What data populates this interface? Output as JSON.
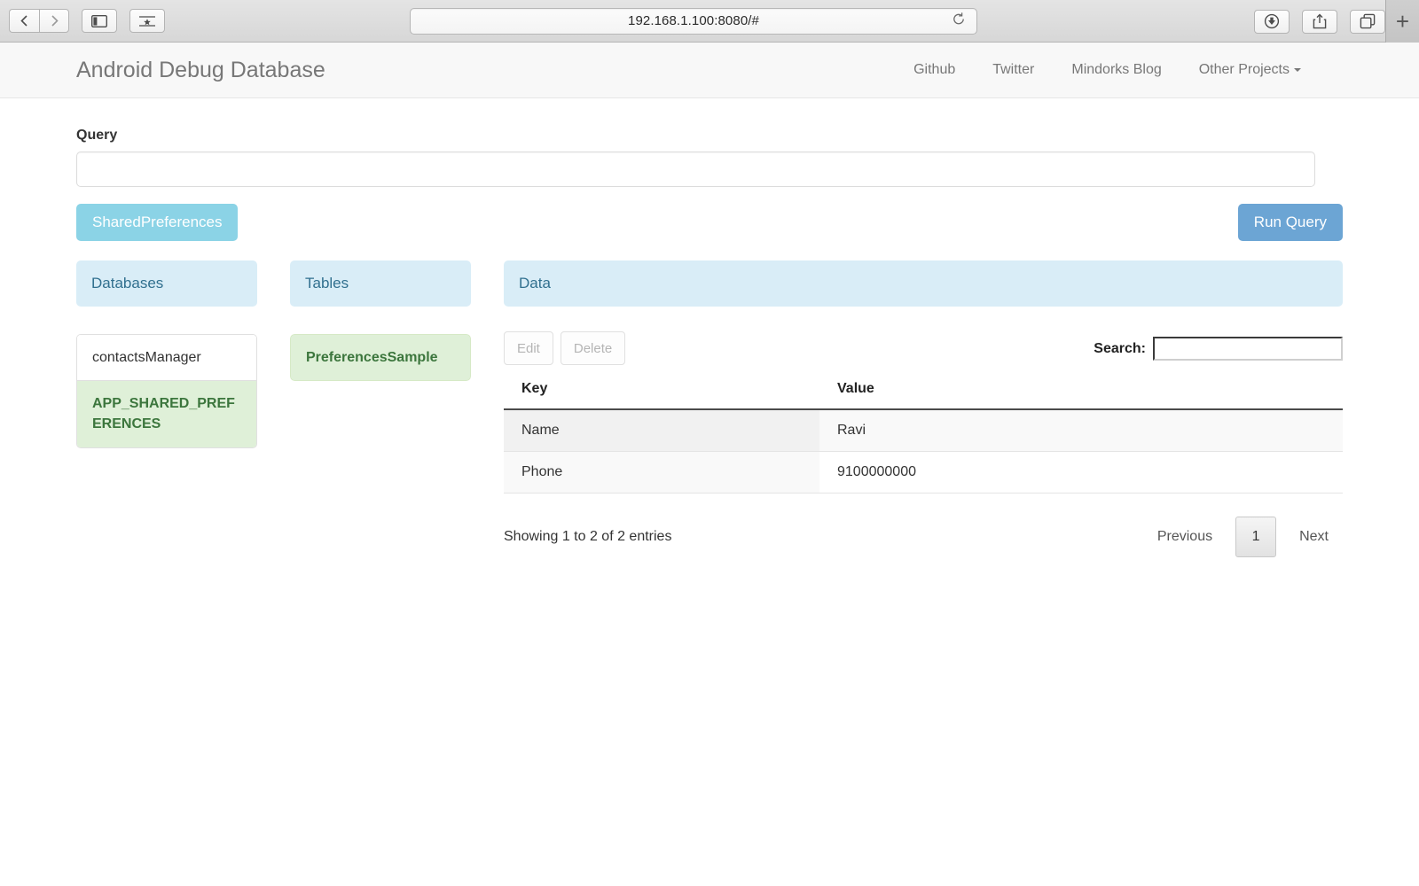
{
  "browser": {
    "url": "192.168.1.100:8080/#",
    "back_icon": "chevron-left-icon",
    "forward_icon": "chevron-right-icon",
    "sidebar_icon": "sidebar-toggle-icon",
    "bookmarks_icon": "bookmarks-star-icon",
    "reload_icon": "reload-icon",
    "downloads_icon": "downloads-icon",
    "share_icon": "share-icon",
    "tabs_icon": "tab-overview-icon",
    "newtab_label": "+"
  },
  "navbar": {
    "brand": "Android Debug Database",
    "links": [
      {
        "label": "Github"
      },
      {
        "label": "Twitter"
      },
      {
        "label": "Mindorks Blog"
      },
      {
        "label": "Other Projects",
        "has_caret": true
      }
    ]
  },
  "query": {
    "label": "Query",
    "value": "",
    "placeholder": ""
  },
  "actions": {
    "shared_preferences_label": "SharedPreferences",
    "run_query_label": "Run Query"
  },
  "panels": {
    "databases": {
      "title": "Databases",
      "items": [
        {
          "label": "contactsManager",
          "selected": false
        },
        {
          "label": "APP_SHARED_PREFERENCES",
          "selected": true
        }
      ]
    },
    "tables": {
      "title": "Tables",
      "items": [
        {
          "label": "PreferencesSample",
          "selected": true
        }
      ]
    },
    "data": {
      "title": "Data"
    }
  },
  "table": {
    "edit_label": "Edit",
    "delete_label": "Delete",
    "search_label": "Search:",
    "search_value": "",
    "search_placeholder": "",
    "columns": [
      "Key",
      "Value"
    ],
    "rows": [
      [
        "Name",
        "Ravi"
      ],
      [
        "Phone",
        "9100000000"
      ]
    ],
    "entries_info": "Showing 1 to 2 of 2 entries",
    "pagination": {
      "previous_label": "Previous",
      "current_page": "1",
      "next_label": "Next"
    }
  },
  "colors": {
    "panel_head_bg": "#d9edf7",
    "panel_head_text": "#31708f",
    "selected_bg": "#dff0d8",
    "selected_text": "#3c763d",
    "btn_info": "#8bd3e6",
    "btn_primary": "#6ca5d4",
    "navbar_bg": "#f8f8f8"
  }
}
